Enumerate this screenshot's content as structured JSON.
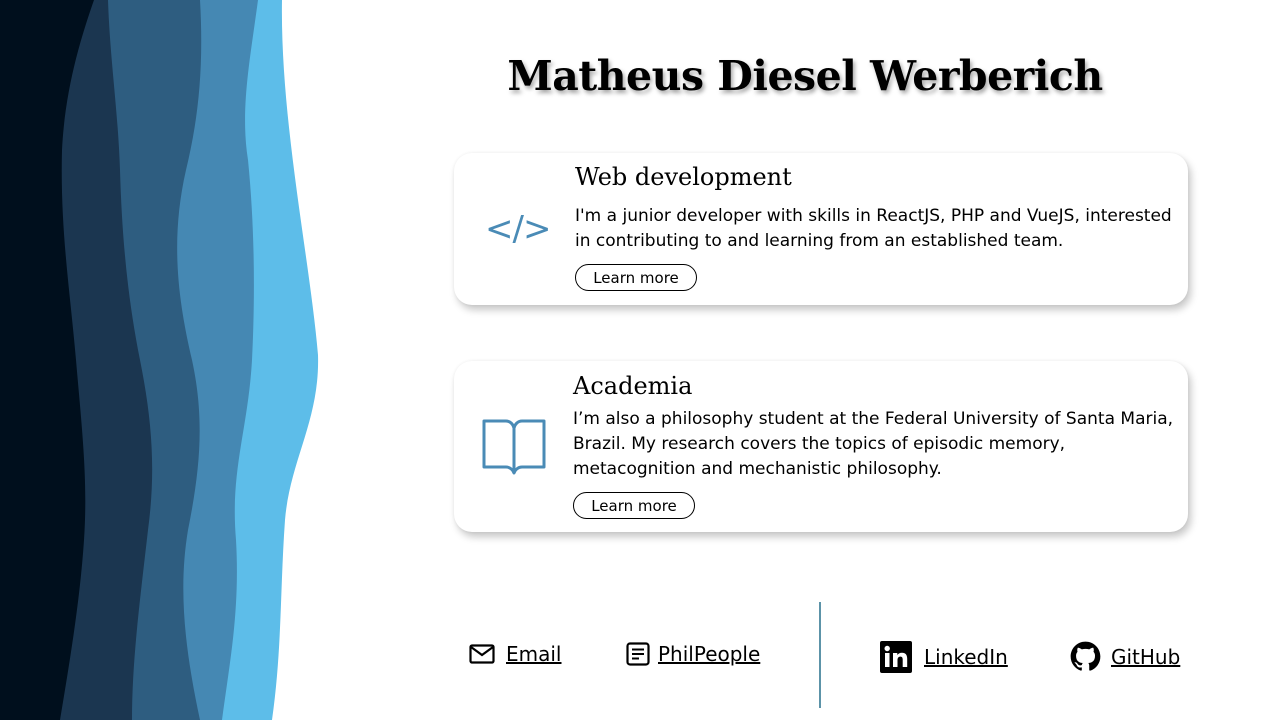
{
  "header": {
    "name": "Matheus Diesel Werberich"
  },
  "cards": [
    {
      "icon": "code-icon",
      "icon_glyph": "</>",
      "title": "Web development",
      "text": "I'm a junior developer with skills in ReactJS, PHP and VueJS, interested in contributing to and learning from an established team.",
      "button": "Learn more"
    },
    {
      "icon": "open-book-icon",
      "title": "Academia",
      "text": "I’m also a philosophy student at the Federal University of Santa Maria, Brazil. My research covers the topics of episodic memory, metacognition and mechanistic philosophy.",
      "button": "Learn more"
    }
  ],
  "links": [
    {
      "icon": "mail-icon",
      "label": "Email"
    },
    {
      "icon": "document-icon",
      "label": "PhilPeople"
    },
    {
      "icon": "linkedin-icon",
      "label": "LinkedIn"
    },
    {
      "icon": "github-icon",
      "label": "GitHub"
    }
  ],
  "colors": {
    "wave_1": "#000f1d",
    "wave_2": "#1b3650",
    "wave_3": "#2e5d80",
    "wave_4": "#4588b3",
    "wave_5": "#5dbde9",
    "accent": "#4a8bb6",
    "divider": "#5c93a8"
  }
}
